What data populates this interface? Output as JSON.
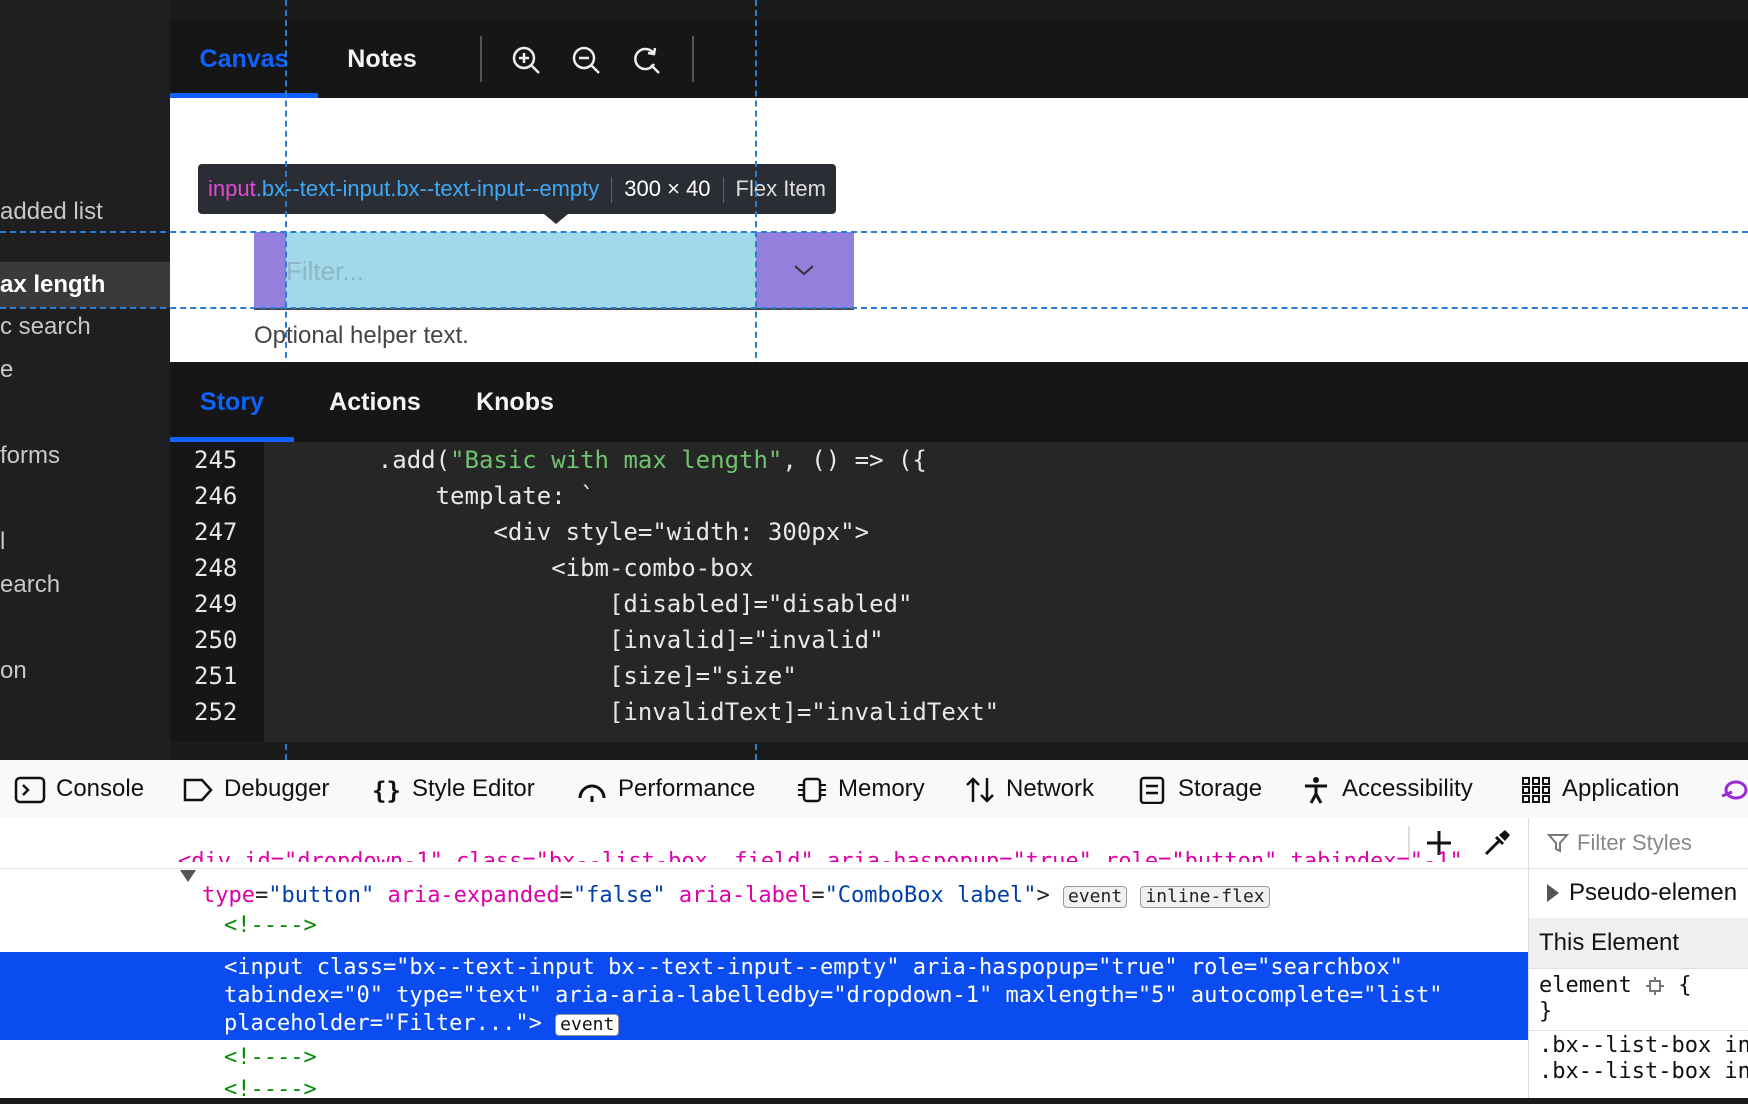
{
  "sidebar": {
    "items": [
      {
        "label": "added list"
      },
      {
        "label": "ax length"
      },
      {
        "label": "c search"
      },
      {
        "label": "e"
      },
      {
        "label": "forms"
      },
      {
        "label": "l"
      },
      {
        "label": "earch"
      },
      {
        "label": "on"
      }
    ]
  },
  "top_toolbar": {
    "tabs": [
      {
        "label": "Canvas"
      },
      {
        "label": "Notes"
      }
    ],
    "icons": [
      "zoom-in-icon",
      "zoom-out-icon",
      "reset-zoom-icon"
    ]
  },
  "canvas": {
    "tooltip": {
      "tag": "input",
      "classes": ".bx--text-input.bx--text-input--empty",
      "size": "300 × 40",
      "type": "Flex Item"
    },
    "combo_placeholder": "Filter...",
    "helper_text": "Optional helper text."
  },
  "story_toolbar": {
    "tabs": [
      {
        "label": "Story"
      },
      {
        "label": "Actions"
      },
      {
        "label": "Knobs"
      }
    ]
  },
  "code": {
    "lines": [
      {
        "num": "245",
        "pre": "    .add(",
        "str": "\"Basic with max length\"",
        "post": ", () => ({"
      },
      {
        "num": "246",
        "pre": "        template: `",
        "str": "",
        "post": ""
      },
      {
        "num": "247",
        "pre": "            <div style=\"width: 300px\">",
        "str": "",
        "post": ""
      },
      {
        "num": "248",
        "pre": "                <ibm-combo-box",
        "str": "",
        "post": ""
      },
      {
        "num": "249",
        "pre": "                    [disabled]=\"disabled\"",
        "str": "",
        "post": ""
      },
      {
        "num": "250",
        "pre": "                    [invalid]=\"invalid\"",
        "str": "",
        "post": ""
      },
      {
        "num": "251",
        "pre": "                    [size]=\"size\"",
        "str": "",
        "post": ""
      },
      {
        "num": "252",
        "pre": "                    [invalidText]=\"invalidText\"",
        "str": "",
        "post": ""
      }
    ]
  },
  "devtools": {
    "tabs": [
      {
        "label": "Console",
        "icon": "console-icon"
      },
      {
        "label": "Debugger",
        "icon": "debugger-icon"
      },
      {
        "label": "Style Editor",
        "icon": "style-editor-icon"
      },
      {
        "label": "Performance",
        "icon": "performance-icon"
      },
      {
        "label": "Memory",
        "icon": "memory-icon"
      },
      {
        "label": "Network",
        "icon": "network-icon"
      },
      {
        "label": "Storage",
        "icon": "storage-icon"
      },
      {
        "label": "Accessibility",
        "icon": "accessibility-icon"
      },
      {
        "label": "Application",
        "icon": "application-icon"
      }
    ]
  },
  "inspector": {
    "row0": "<div id=\"dropdown-1\" class=\"bx--list-box__field\" aria-haspopup=\"true\" role=\"button\" tabindex=\"-1\"",
    "row1_parts": {
      "a1": "type",
      "v1": "\"button\"",
      "a2": "aria-expanded",
      "v2": "\"false\"",
      "a3": "aria-label",
      "v3": "\"ComboBox label\""
    },
    "badge_event": "event",
    "badge_flex": "inline-flex",
    "comment": "<!---->",
    "selected_lines": [
      "<input class=\"bx--text-input bx--text-input--empty\" aria-haspopup=\"true\" role=\"searchbox\"",
      "tabindex=\"0\" type=\"text\" aria-aria-labelledby=\"dropdown-1\" maxlength=\"5\" autocomplete=\"list\"",
      "placeholder=\"Filter...\">"
    ]
  },
  "rules": {
    "filter_placeholder": "Filter Styles",
    "pseudo": "Pseudo-elemen",
    "this_element": "This Element",
    "element_rule": "element",
    "brace_open": "{",
    "brace_close": "}",
    "sel1": ".bx--list-box in",
    "sel2": ".bx--list-box in"
  }
}
